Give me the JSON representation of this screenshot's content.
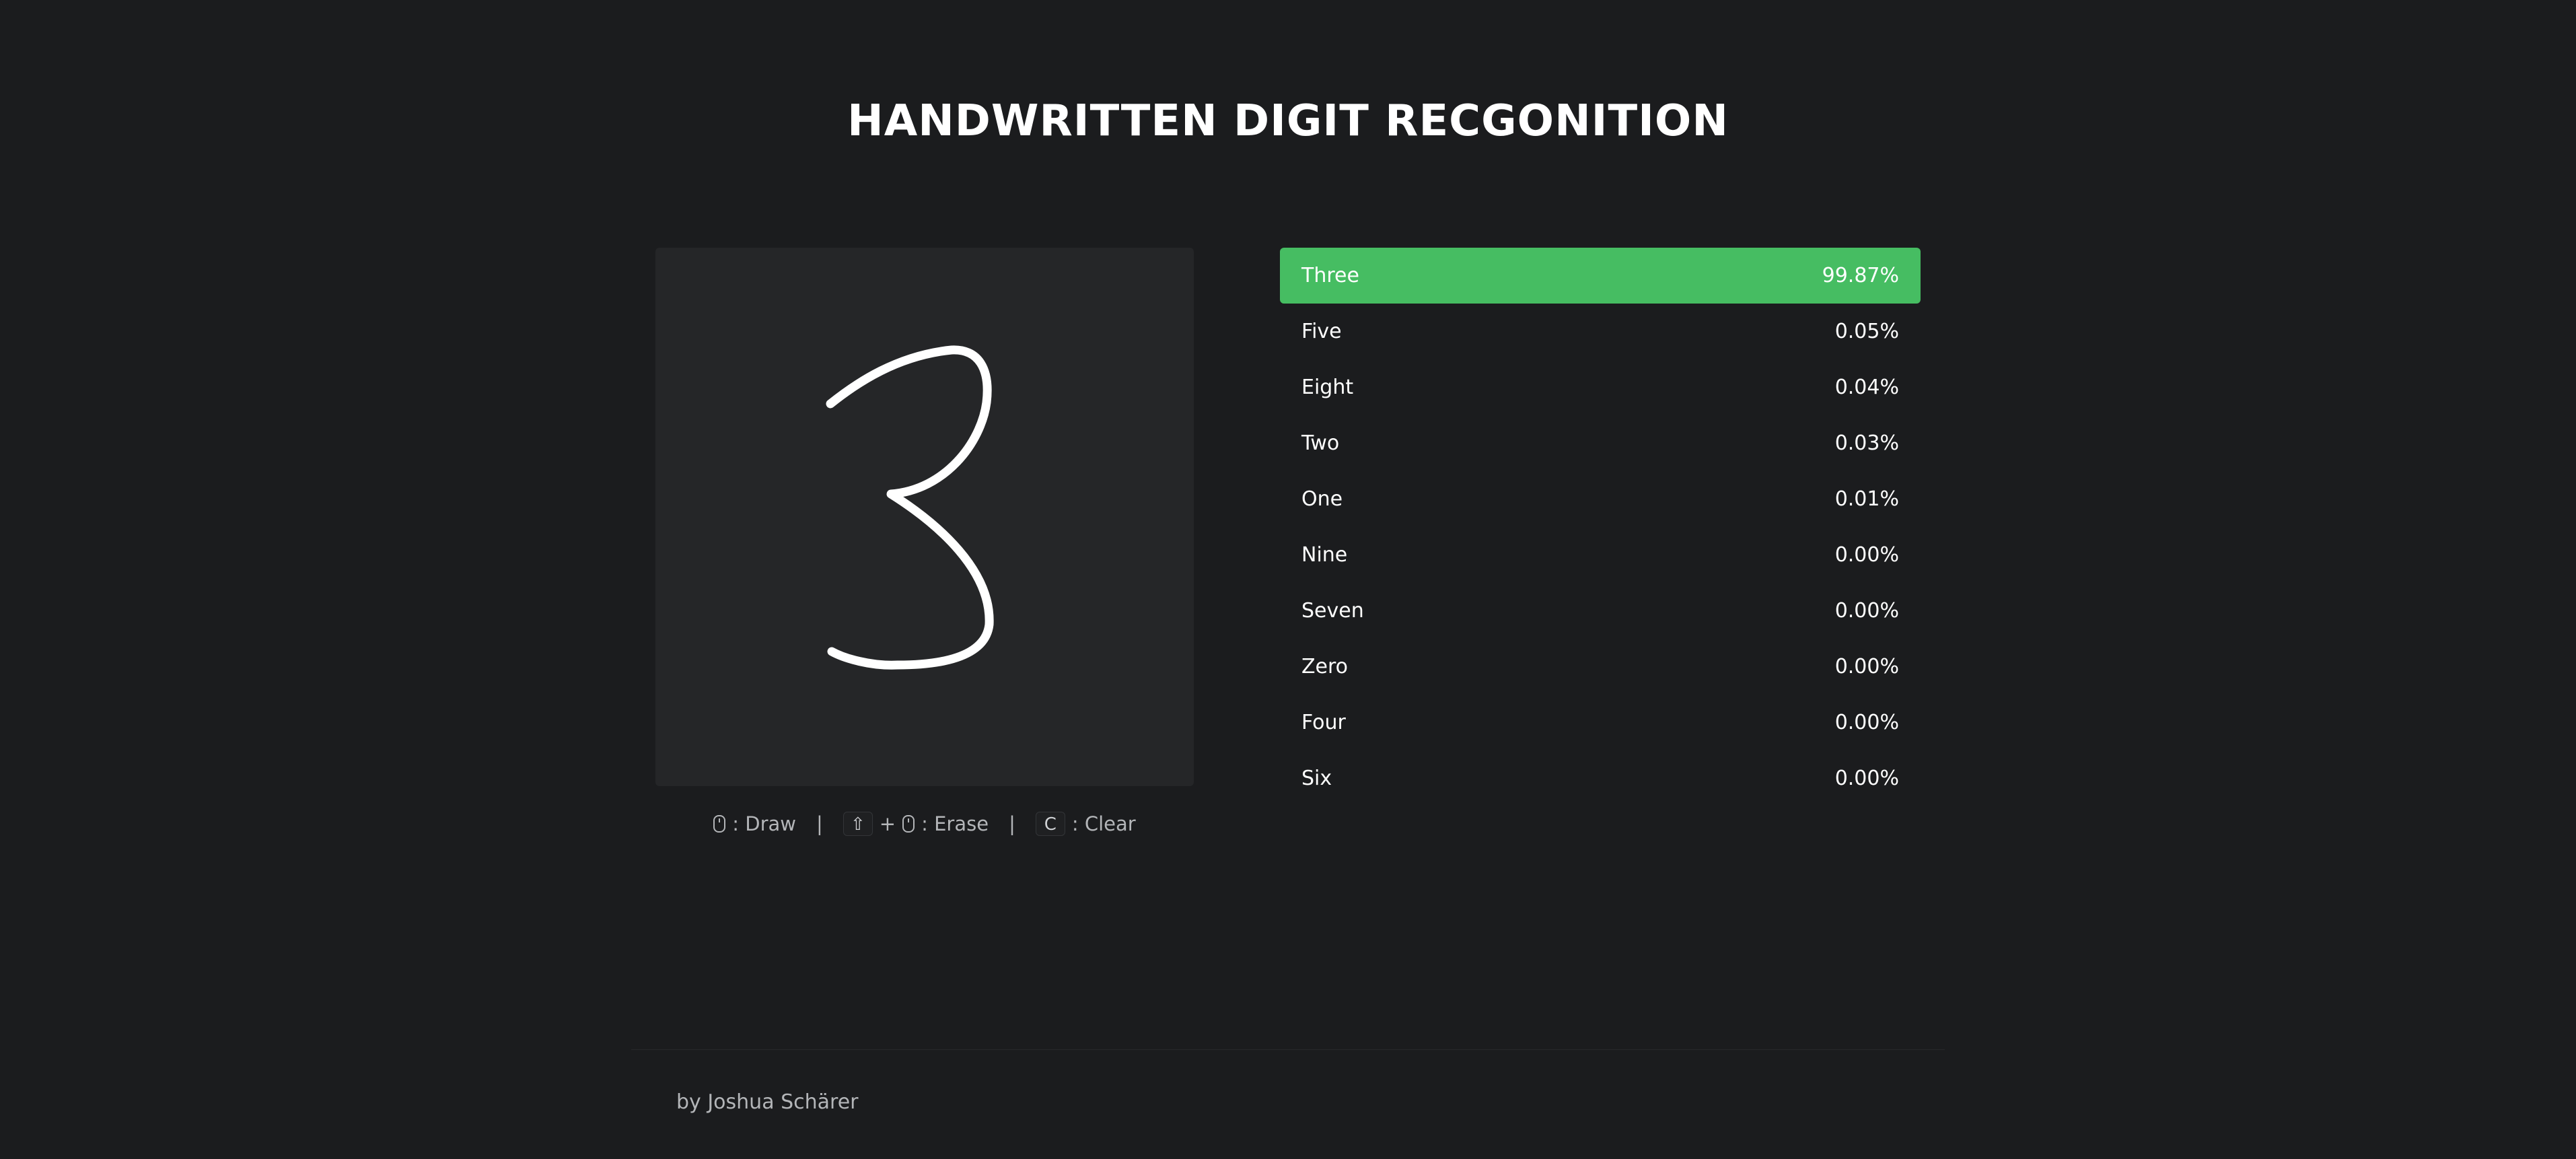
{
  "title": "HANDWRITTEN DIGIT RECGONITION",
  "controls": {
    "draw_label": ": Draw",
    "separator": "|",
    "shift_key": "⇧",
    "plus": "+",
    "erase_label": ": Erase",
    "clear_key": "C",
    "clear_label": ": Clear"
  },
  "predictions": [
    {
      "label": "Three",
      "value": "99.87%"
    },
    {
      "label": "Five",
      "value": "0.05%"
    },
    {
      "label": "Eight",
      "value": "0.04%"
    },
    {
      "label": "Two",
      "value": "0.03%"
    },
    {
      "label": "One",
      "value": "0.01%"
    },
    {
      "label": "Nine",
      "value": "0.00%"
    },
    {
      "label": "Seven",
      "value": "0.00%"
    },
    {
      "label": "Zero",
      "value": "0.00%"
    },
    {
      "label": "Four",
      "value": "0.00%"
    },
    {
      "label": "Six",
      "value": "0.00%"
    }
  ],
  "footer": {
    "author": "by Joshua Schärer"
  },
  "colors": {
    "background": "#1b1c1e",
    "canvas": "#252628",
    "accent": "#46bd62"
  },
  "icons": {
    "mouse": "mouse-icon",
    "shift": "shift-key-icon"
  }
}
